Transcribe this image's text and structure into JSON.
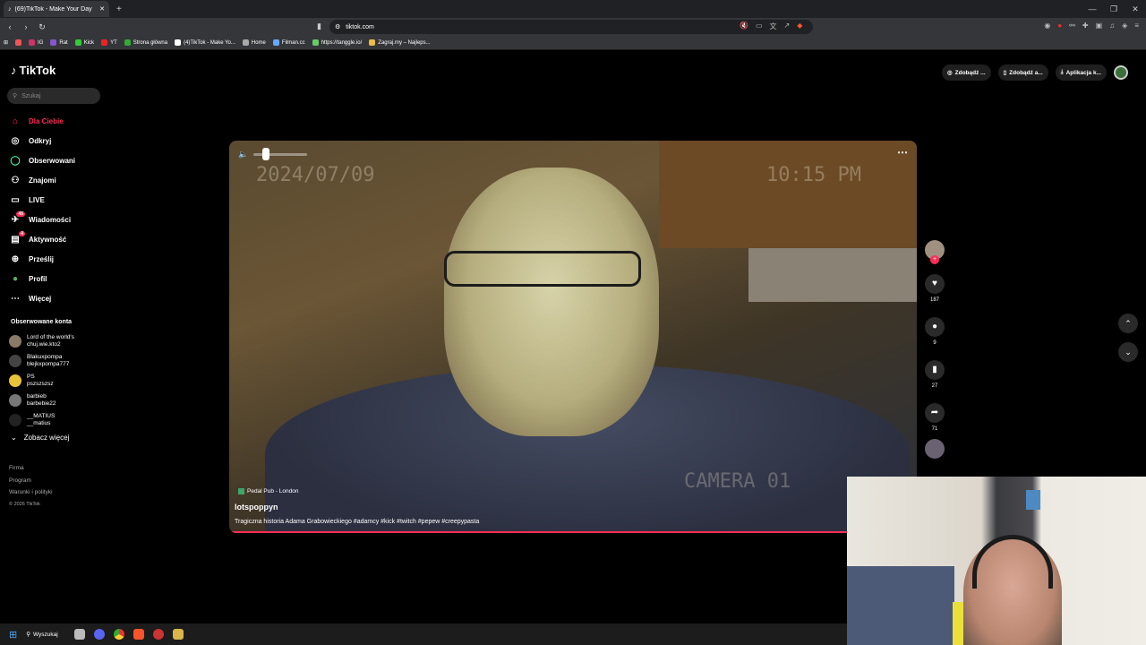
{
  "browser": {
    "tab_title": "(69)TikTok - Make Your Day",
    "url": "tiktok.com",
    "bookmarks": [
      "IG",
      "Rat",
      "Kick",
      "YT",
      "Strona główna",
      "(4)TikTok - Make Yo...",
      "Home",
      "Filman.cc",
      "https://tanggle.io/",
      "Zagraj.my – Najleps..."
    ]
  },
  "tiktok": {
    "logo": "TikTok",
    "search_placeholder": "Szukaj",
    "nav": [
      "Dla Ciebie",
      "Odkryj",
      "Obserwowani",
      "Znajomi",
      "LIVE",
      "Wiadomości",
      "Aktywność",
      "Prześlij",
      "Profil",
      "Więcej"
    ],
    "nav_badges": {
      "messages": "45",
      "activity": "4"
    },
    "followed_title": "Obserwowane konta",
    "followed": [
      {
        "name": "Lord of the world's",
        "handle": "chuj.wie.kto2"
      },
      {
        "name": "Blakuxpompa",
        "handle": "blejkxpompa777"
      },
      {
        "name": "PS",
        "handle": "pszszszsz"
      },
      {
        "name": "barbieb",
        "handle": "barbebie22"
      },
      {
        "name": "__MATIUS",
        "handle": "__matius"
      }
    ],
    "see_more": "Zobacz więcej",
    "footer": [
      "Firma",
      "Program",
      "Warunki i polityki"
    ],
    "copyright": "© 2026 TikTok",
    "top_pills": [
      "Zdobądź ...",
      "Zdobądź a...",
      "Aplikacja k..."
    ]
  },
  "video": {
    "date_stamp": "2024/07/09",
    "time_stamp": "10:15 PM",
    "camera_stamp": "CAMERA 01",
    "music": "Pedal Pub - London",
    "author": "lotspoppyn",
    "description": "Tragiczna historia Adama Grabowieckiego #adamcy #kick #twitch #pepew #creepypasta",
    "progress_pct": 90,
    "likes": "187",
    "comments": "9",
    "saves": "27",
    "shares": "71"
  },
  "taskbar": {
    "search_label": "Wyszukaj"
  },
  "colors": {
    "accent": "#fe2c55"
  }
}
